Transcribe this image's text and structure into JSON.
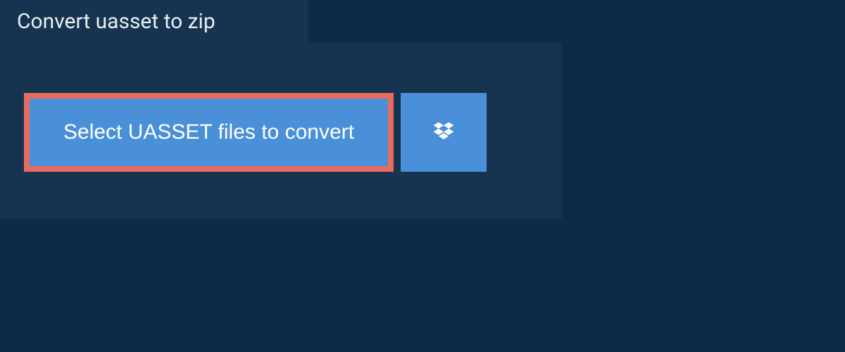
{
  "tab": {
    "title": "Convert uasset to zip"
  },
  "buttons": {
    "select_label": "Select UASSET files to convert"
  }
}
